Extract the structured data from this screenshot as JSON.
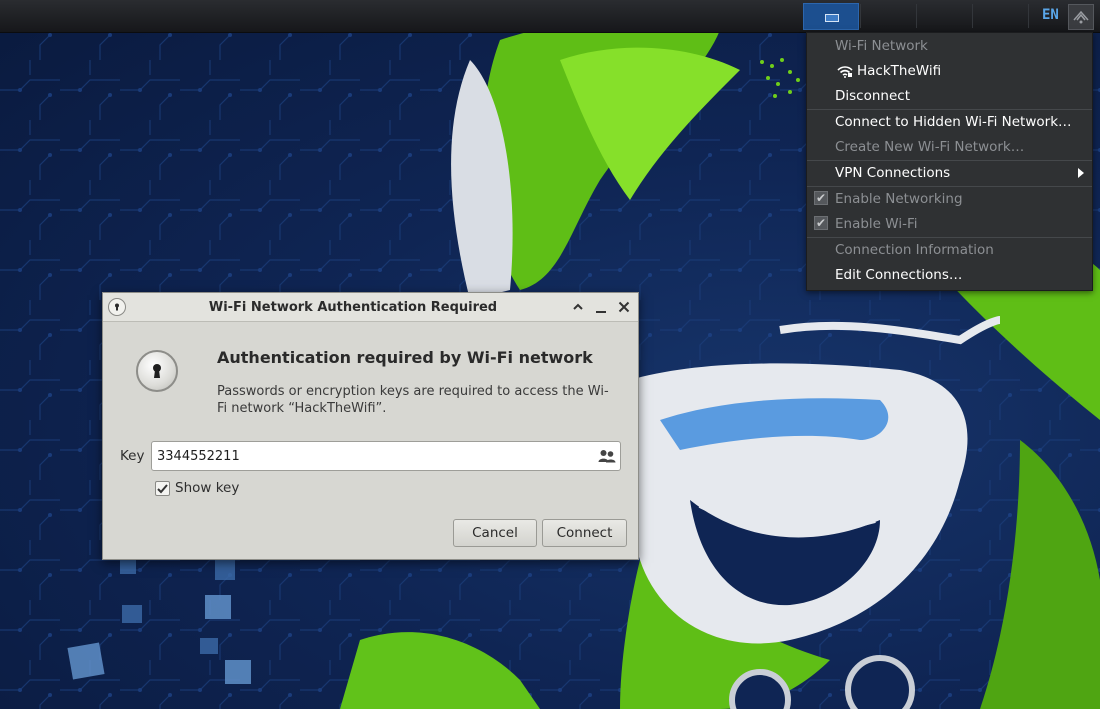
{
  "panel": {
    "language": "EN"
  },
  "network_menu": {
    "section_header": "Wi-Fi Network",
    "connected_network": "HackTheWifi",
    "disconnect": "Disconnect",
    "connect_hidden": "Connect to Hidden Wi-Fi Network…",
    "create_new": "Create New Wi-Fi Network…",
    "vpn": "VPN Connections",
    "enable_networking": "Enable Networking",
    "enable_wifi": "Enable Wi-Fi",
    "connection_info": "Connection Information",
    "edit_connections": "Edit Connections…",
    "enable_networking_checked": true,
    "enable_wifi_checked": true
  },
  "dialog": {
    "title": "Wi-Fi Network Authentication Required",
    "heading": "Authentication required by Wi-Fi network",
    "body_line1": "Passwords or encryption keys are required to access the Wi-",
    "body_line2": "Fi network “HackTheWifi”.",
    "key_label": "Key",
    "key_value": "3344552211",
    "show_key_label": "Show key",
    "show_key_checked": true,
    "cancel_label": "Cancel",
    "connect_label": "Connect"
  },
  "colors": {
    "wallpaper_bg": "#0f2554",
    "accent_green": "#6fce1a",
    "menu_bg": "#2f3133",
    "dialog_bg": "#d7d7d2",
    "highlight_blue": "#1c4f8f"
  },
  "icons": {
    "dialog_title": "lock-icon",
    "dialog_main": "padlock-icon",
    "wifi": "wifi-signal-icon",
    "key_field": "people-icon",
    "submenu": "chevron-right-icon"
  }
}
